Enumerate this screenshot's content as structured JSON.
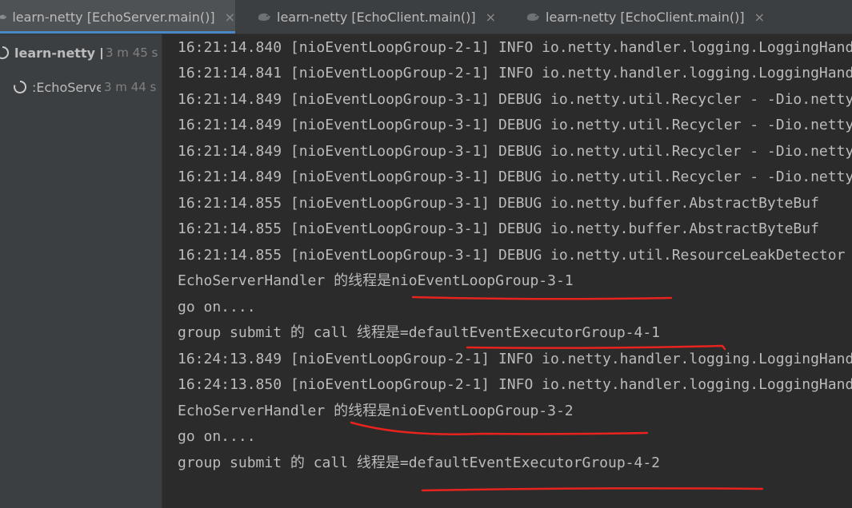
{
  "tabs": [
    {
      "label": "learn-netty [EchoServer.main()]",
      "icon": "netty-run-icon",
      "active": true
    },
    {
      "label": "learn-netty [EchoClient.main()]",
      "icon": "netty-run-icon",
      "active": false
    },
    {
      "label": "learn-netty [EchoClient.main()]",
      "icon": "netty-run-icon",
      "active": false
    }
  ],
  "tab_close_glyph": "×",
  "tree": [
    {
      "label": "learn-netty [EchoServer.main()]",
      "time": "3 m 45 s"
    },
    {
      "label": ":EchoServer.main()",
      "time": "3 m 44 s"
    }
  ],
  "console_lines": [
    "16:21:14.840 [nioEventLoopGroup-2-1] INFO io.netty.handler.logging.LoggingHandler",
    "16:21:14.841 [nioEventLoopGroup-2-1] INFO io.netty.handler.logging.LoggingHandler",
    "16:21:14.849 [nioEventLoopGroup-3-1] DEBUG io.netty.util.Recycler - -Dio.netty",
    "16:21:14.849 [nioEventLoopGroup-3-1] DEBUG io.netty.util.Recycler - -Dio.netty",
    "16:21:14.849 [nioEventLoopGroup-3-1] DEBUG io.netty.util.Recycler - -Dio.netty",
    "16:21:14.849 [nioEventLoopGroup-3-1] DEBUG io.netty.util.Recycler - -Dio.netty",
    "16:21:14.855 [nioEventLoopGroup-3-1] DEBUG io.netty.buffer.AbstractByteBuf",
    "16:21:14.855 [nioEventLoopGroup-3-1] DEBUG io.netty.buffer.AbstractByteBuf",
    "16:21:14.855 [nioEventLoopGroup-3-1] DEBUG io.netty.util.ResourceLeakDetector",
    "EchoServerHandler 的线程是nioEventLoopGroup-3-1",
    "go on....",
    "group submit 的 call 线程是=defaultEventExecutorGroup-4-1",
    "16:24:13.849 [nioEventLoopGroup-2-1] INFO io.netty.handler.logging.LoggingHandler",
    "16:24:13.850 [nioEventLoopGroup-2-1] INFO io.netty.handler.logging.LoggingHandler",
    "EchoServerHandler 的线程是nioEventLoopGroup-3-2",
    "go on....",
    "group submit 的 call 线程是=defaultEventExecutorGroup-4-2"
  ],
  "colors": {
    "console_bg": "#2b2b2b",
    "panel_bg": "#3c3f41",
    "console_text": "#bbbbbb",
    "annotation": "#e8231e",
    "active_tab_underline": "#4a88c7"
  }
}
